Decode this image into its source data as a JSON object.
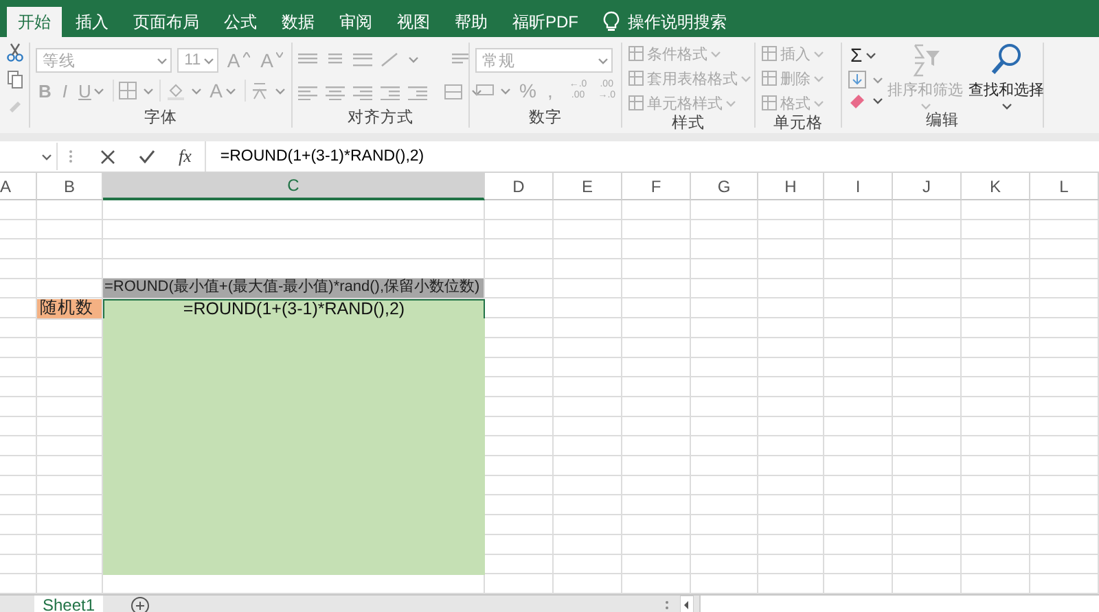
{
  "tabs": [
    {
      "label": "开始",
      "selected": true
    },
    {
      "label": "插入",
      "selected": false
    },
    {
      "label": "页面布局",
      "selected": false
    },
    {
      "label": "公式",
      "selected": false
    },
    {
      "label": "数据",
      "selected": false
    },
    {
      "label": "审阅",
      "selected": false
    },
    {
      "label": "视图",
      "selected": false
    },
    {
      "label": "帮助",
      "selected": false
    },
    {
      "label": "福昕PDF",
      "selected": false
    }
  ],
  "tell_me": {
    "placeholder": "操作说明搜索"
  },
  "ribbon": {
    "groups": [
      {
        "kind": "clipboard"
      },
      {
        "kind": "font",
        "label": "字体",
        "font": {
          "value": "等线",
          "disabled": true
        },
        "size": {
          "value": "11",
          "disabled": true
        },
        "grow": {
          "text": "A",
          "disabled": true
        },
        "shrink": {
          "text": "A",
          "disabled": true
        },
        "bold": {
          "text": "B",
          "disabled": true
        },
        "italic": {
          "text": "I",
          "disabled": true
        },
        "underline": {
          "text": "U",
          "disabled": true
        },
        "color": {
          "text": "A",
          "disabled": true
        }
      },
      {
        "kind": "alignment",
        "label": "对齐方式"
      },
      {
        "kind": "number",
        "label": "数字",
        "format": {
          "value": "常规",
          "disabled": true
        },
        "percent": {
          "text": "%",
          "disabled": true
        },
        "comma": {
          "text": ",",
          "disabled": true
        },
        "more_decimals": {
          "lines": [
            "←.0",
            ".00"
          ],
          "disabled": true
        },
        "fewer_decimals": {
          "lines": [
            ".00",
            "→.0"
          ],
          "disabled": true
        }
      },
      {
        "kind": "styles",
        "label": "样式",
        "items": [
          {
            "text": "条件格式",
            "disabled": true
          },
          {
            "text": "套用表格格式",
            "disabled": true
          },
          {
            "text": "单元格样式",
            "disabled": true
          }
        ]
      },
      {
        "kind": "cells",
        "label": "单元格",
        "items": [
          {
            "text": "插入",
            "disabled": true
          },
          {
            "text": "删除",
            "disabled": true
          },
          {
            "text": "格式",
            "disabled": true
          }
        ]
      },
      {
        "kind": "editing",
        "label": "编辑",
        "autosum": {
          "text": "Σ",
          "disabled": false
        },
        "sort": {
          "text": "排序和筛选",
          "disabled": true
        },
        "find": {
          "text": "查找和选择",
          "disabled": false
        }
      }
    ]
  },
  "formula_bar": {
    "fx": "fx",
    "formula": "=ROUND(1+(3-1)*RAND(),2)"
  },
  "sheet": {
    "columns": [
      {
        "label": "A",
        "selected": false
      },
      {
        "label": "B",
        "selected": false
      },
      {
        "label": "C",
        "selected": true
      },
      {
        "label": "D",
        "selected": false
      },
      {
        "label": "E",
        "selected": false
      },
      {
        "label": "F",
        "selected": false
      },
      {
        "label": "G",
        "selected": false
      },
      {
        "label": "H",
        "selected": false
      },
      {
        "label": "I",
        "selected": false
      },
      {
        "label": "J",
        "selected": false
      },
      {
        "label": "K",
        "selected": false
      },
      {
        "label": "L",
        "selected": false
      }
    ],
    "rows": [
      {
        "kind": "blank"
      },
      {
        "kind": "blank"
      },
      {
        "kind": "blank"
      },
      {
        "kind": "blank"
      },
      {
        "kind": "heading",
        "value": "=ROUND(最小值+(最大值-最小值)*rand(),保留小数位数)"
      },
      {
        "kind": "entry",
        "label": "随机数",
        "value": "=ROUND(1+(3-1)*RAND(),2)"
      },
      {
        "kind": "filled"
      },
      {
        "kind": "filled"
      },
      {
        "kind": "filled"
      },
      {
        "kind": "filled"
      },
      {
        "kind": "filled"
      },
      {
        "kind": "filled"
      },
      {
        "kind": "filled"
      },
      {
        "kind": "filled"
      },
      {
        "kind": "filled"
      },
      {
        "kind": "filled"
      },
      {
        "kind": "filled"
      },
      {
        "kind": "filled"
      },
      {
        "kind": "filled"
      },
      {
        "kind": "blank"
      }
    ]
  },
  "sheet_tabs": [
    {
      "label": "Sheet1",
      "selected": true
    }
  ]
}
